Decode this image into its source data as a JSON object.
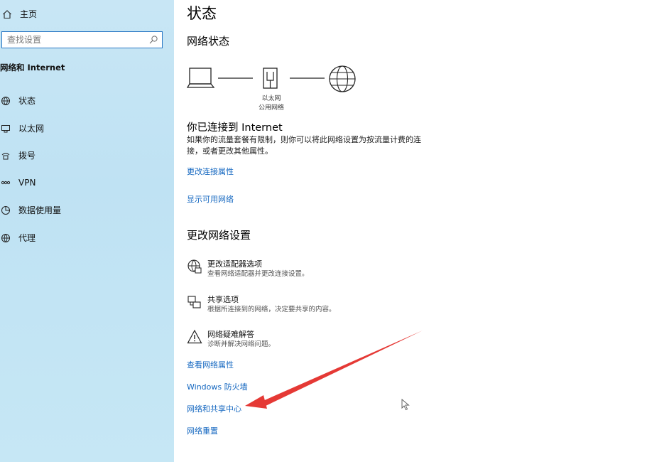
{
  "sidebar": {
    "home_label": "主页",
    "search_placeholder": "查找设置",
    "section_title": "网络和 Internet",
    "items": [
      {
        "label": "状态",
        "icon": "status-icon"
      },
      {
        "label": "以太网",
        "icon": "ethernet-icon"
      },
      {
        "label": "拨号",
        "icon": "dialup-icon"
      },
      {
        "label": "VPN",
        "icon": "vpn-icon"
      },
      {
        "label": "数据使用量",
        "icon": "data-usage-icon"
      },
      {
        "label": "代理",
        "icon": "proxy-icon"
      }
    ]
  },
  "main": {
    "title": "状态",
    "network_status_heading": "网络状态",
    "diagram": {
      "adapter_name": "以太网",
      "network_type": "公用网络",
      "icons": [
        "laptop-icon",
        "ethernet-port-icon",
        "globe-icon"
      ]
    },
    "connected_title": "你已连接到 Internet",
    "connected_desc": "如果你的流量套餐有限制，则你可以将此网络设置为按流量计费的连接，或者更改其他属性。",
    "link_change_properties": "更改连接属性",
    "link_show_networks": "显示可用网络",
    "change_settings_heading": "更改网络设置",
    "options": [
      {
        "title": "更改适配器选项",
        "subtitle": "查看网络适配器并更改连接设置。",
        "icon": "adapter-icon"
      },
      {
        "title": "共享选项",
        "subtitle": "根据所连接到的网络，决定要共享的内容。",
        "icon": "sharing-icon"
      },
      {
        "title": "网络疑难解答",
        "subtitle": "诊断并解决网络问题。",
        "icon": "warning-icon"
      }
    ],
    "bottom_links": [
      "查看网络属性",
      "Windows 防火墙",
      "网络和共享中心",
      "网络重置"
    ]
  },
  "colors": {
    "sidebar_bg": "#c6e6f5",
    "link": "#1467c0",
    "search_border": "#2b78c4",
    "annotation_arrow": "#e53935"
  }
}
